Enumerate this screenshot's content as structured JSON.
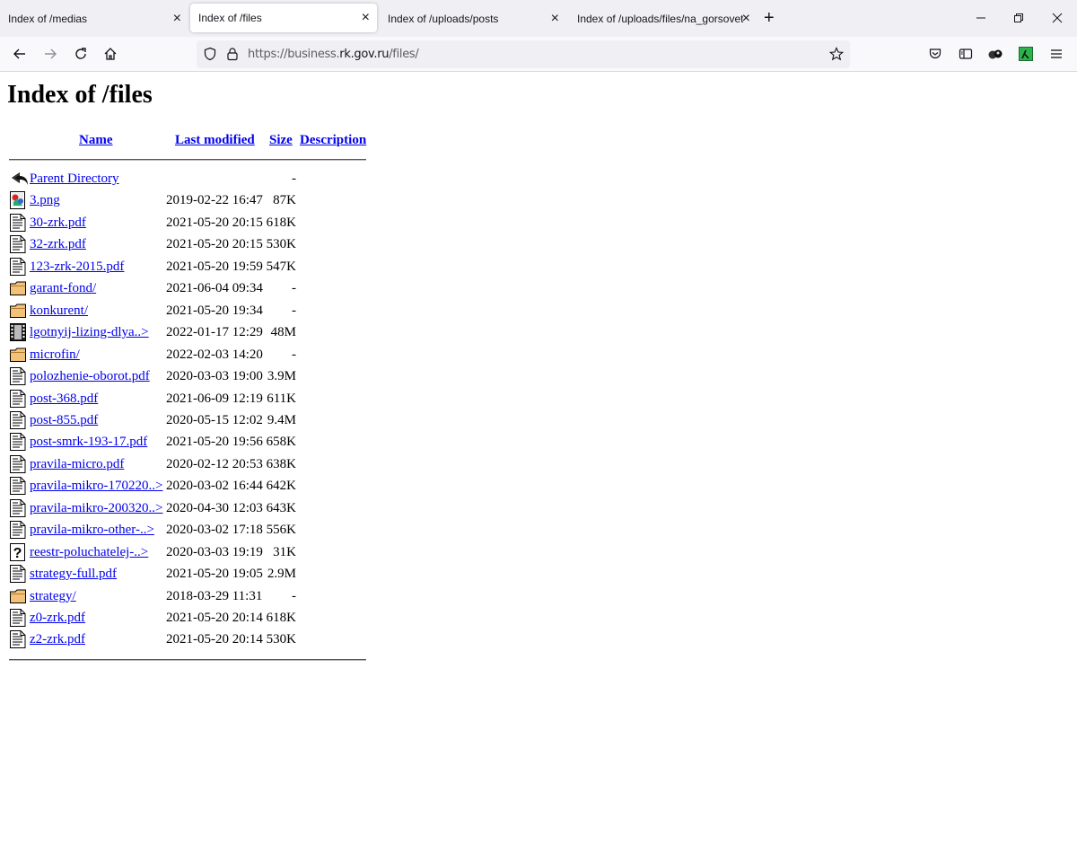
{
  "browser": {
    "tabs": [
      {
        "title": "Index of /medias"
      },
      {
        "title": "Index of /files"
      },
      {
        "title": "Index of /uploads/posts"
      },
      {
        "title": "Index of /uploads/files/na_gorsovet"
      }
    ],
    "url": {
      "prefix": "https://business.",
      "domain": "rk.gov.ru",
      "suffix": "/files/"
    }
  },
  "page": {
    "title": "Index of /files",
    "columns": {
      "name": "Name",
      "last_modified": "Last modified",
      "size": "Size",
      "description": "Description"
    },
    "entries": [
      {
        "name": "Parent Directory",
        "date": "",
        "size": "-",
        "icon": "back-icon"
      },
      {
        "name": "3.png",
        "date": "2019-02-22 16:47",
        "size": "87K",
        "icon": "image-file-icon"
      },
      {
        "name": "30-zrk.pdf",
        "date": "2021-05-20 20:15",
        "size": "618K",
        "icon": "document-icon"
      },
      {
        "name": "32-zrk.pdf",
        "date": "2021-05-20 20:15",
        "size": "530K",
        "icon": "document-icon"
      },
      {
        "name": "123-zrk-2015.pdf",
        "date": "2021-05-20 19:59",
        "size": "547K",
        "icon": "document-icon"
      },
      {
        "name": "garant-fond/",
        "date": "2021-06-04 09:34",
        "size": "-",
        "icon": "folder-icon"
      },
      {
        "name": "konkurent/",
        "date": "2021-05-20 19:34",
        "size": "-",
        "icon": "folder-icon"
      },
      {
        "name": "lgotnyij-lizing-dlya..>",
        "date": "2022-01-17 12:29",
        "size": "48M",
        "icon": "video-file-icon"
      },
      {
        "name": "microfin/",
        "date": "2022-02-03 14:20",
        "size": "-",
        "icon": "folder-icon"
      },
      {
        "name": "polozhenie-oborot.pdf",
        "date": "2020-03-03 19:00",
        "size": "3.9M",
        "icon": "document-icon"
      },
      {
        "name": "post-368.pdf",
        "date": "2021-06-09 12:19",
        "size": "611K",
        "icon": "document-icon"
      },
      {
        "name": "post-855.pdf",
        "date": "2020-05-15 12:02",
        "size": "9.4M",
        "icon": "document-icon"
      },
      {
        "name": "post-smrk-193-17.pdf",
        "date": "2021-05-20 19:56",
        "size": "658K",
        "icon": "document-icon"
      },
      {
        "name": "pravila-micro.pdf",
        "date": "2020-02-12 20:53",
        "size": "638K",
        "icon": "document-icon"
      },
      {
        "name": "pravila-mikro-170220..>",
        "date": "2020-03-02 16:44",
        "size": "642K",
        "icon": "document-icon"
      },
      {
        "name": "pravila-mikro-200320..>",
        "date": "2020-04-30 12:03",
        "size": "643K",
        "icon": "document-icon"
      },
      {
        "name": "pravila-mikro-other-..>",
        "date": "2020-03-02 17:18",
        "size": "556K",
        "icon": "document-icon"
      },
      {
        "name": "reestr-poluchatelej-..>",
        "date": "2020-03-03 19:19",
        "size": "31K",
        "icon": "unknown-file-icon"
      },
      {
        "name": "strategy-full.pdf",
        "date": "2021-05-20 19:05",
        "size": "2.9M",
        "icon": "document-icon"
      },
      {
        "name": "strategy/",
        "date": "2018-03-29 11:31",
        "size": "-",
        "icon": "folder-icon"
      },
      {
        "name": "z0-zrk.pdf",
        "date": "2021-05-20 20:14",
        "size": "618K",
        "icon": "document-icon"
      },
      {
        "name": "z2-zrk.pdf",
        "date": "2021-05-20 20:14",
        "size": "530K",
        "icon": "document-icon"
      }
    ]
  },
  "colors": {
    "link": "#0000ee",
    "tabbar_bg": "#f0f0f4",
    "toolbar_bg": "#f9f9fb"
  }
}
